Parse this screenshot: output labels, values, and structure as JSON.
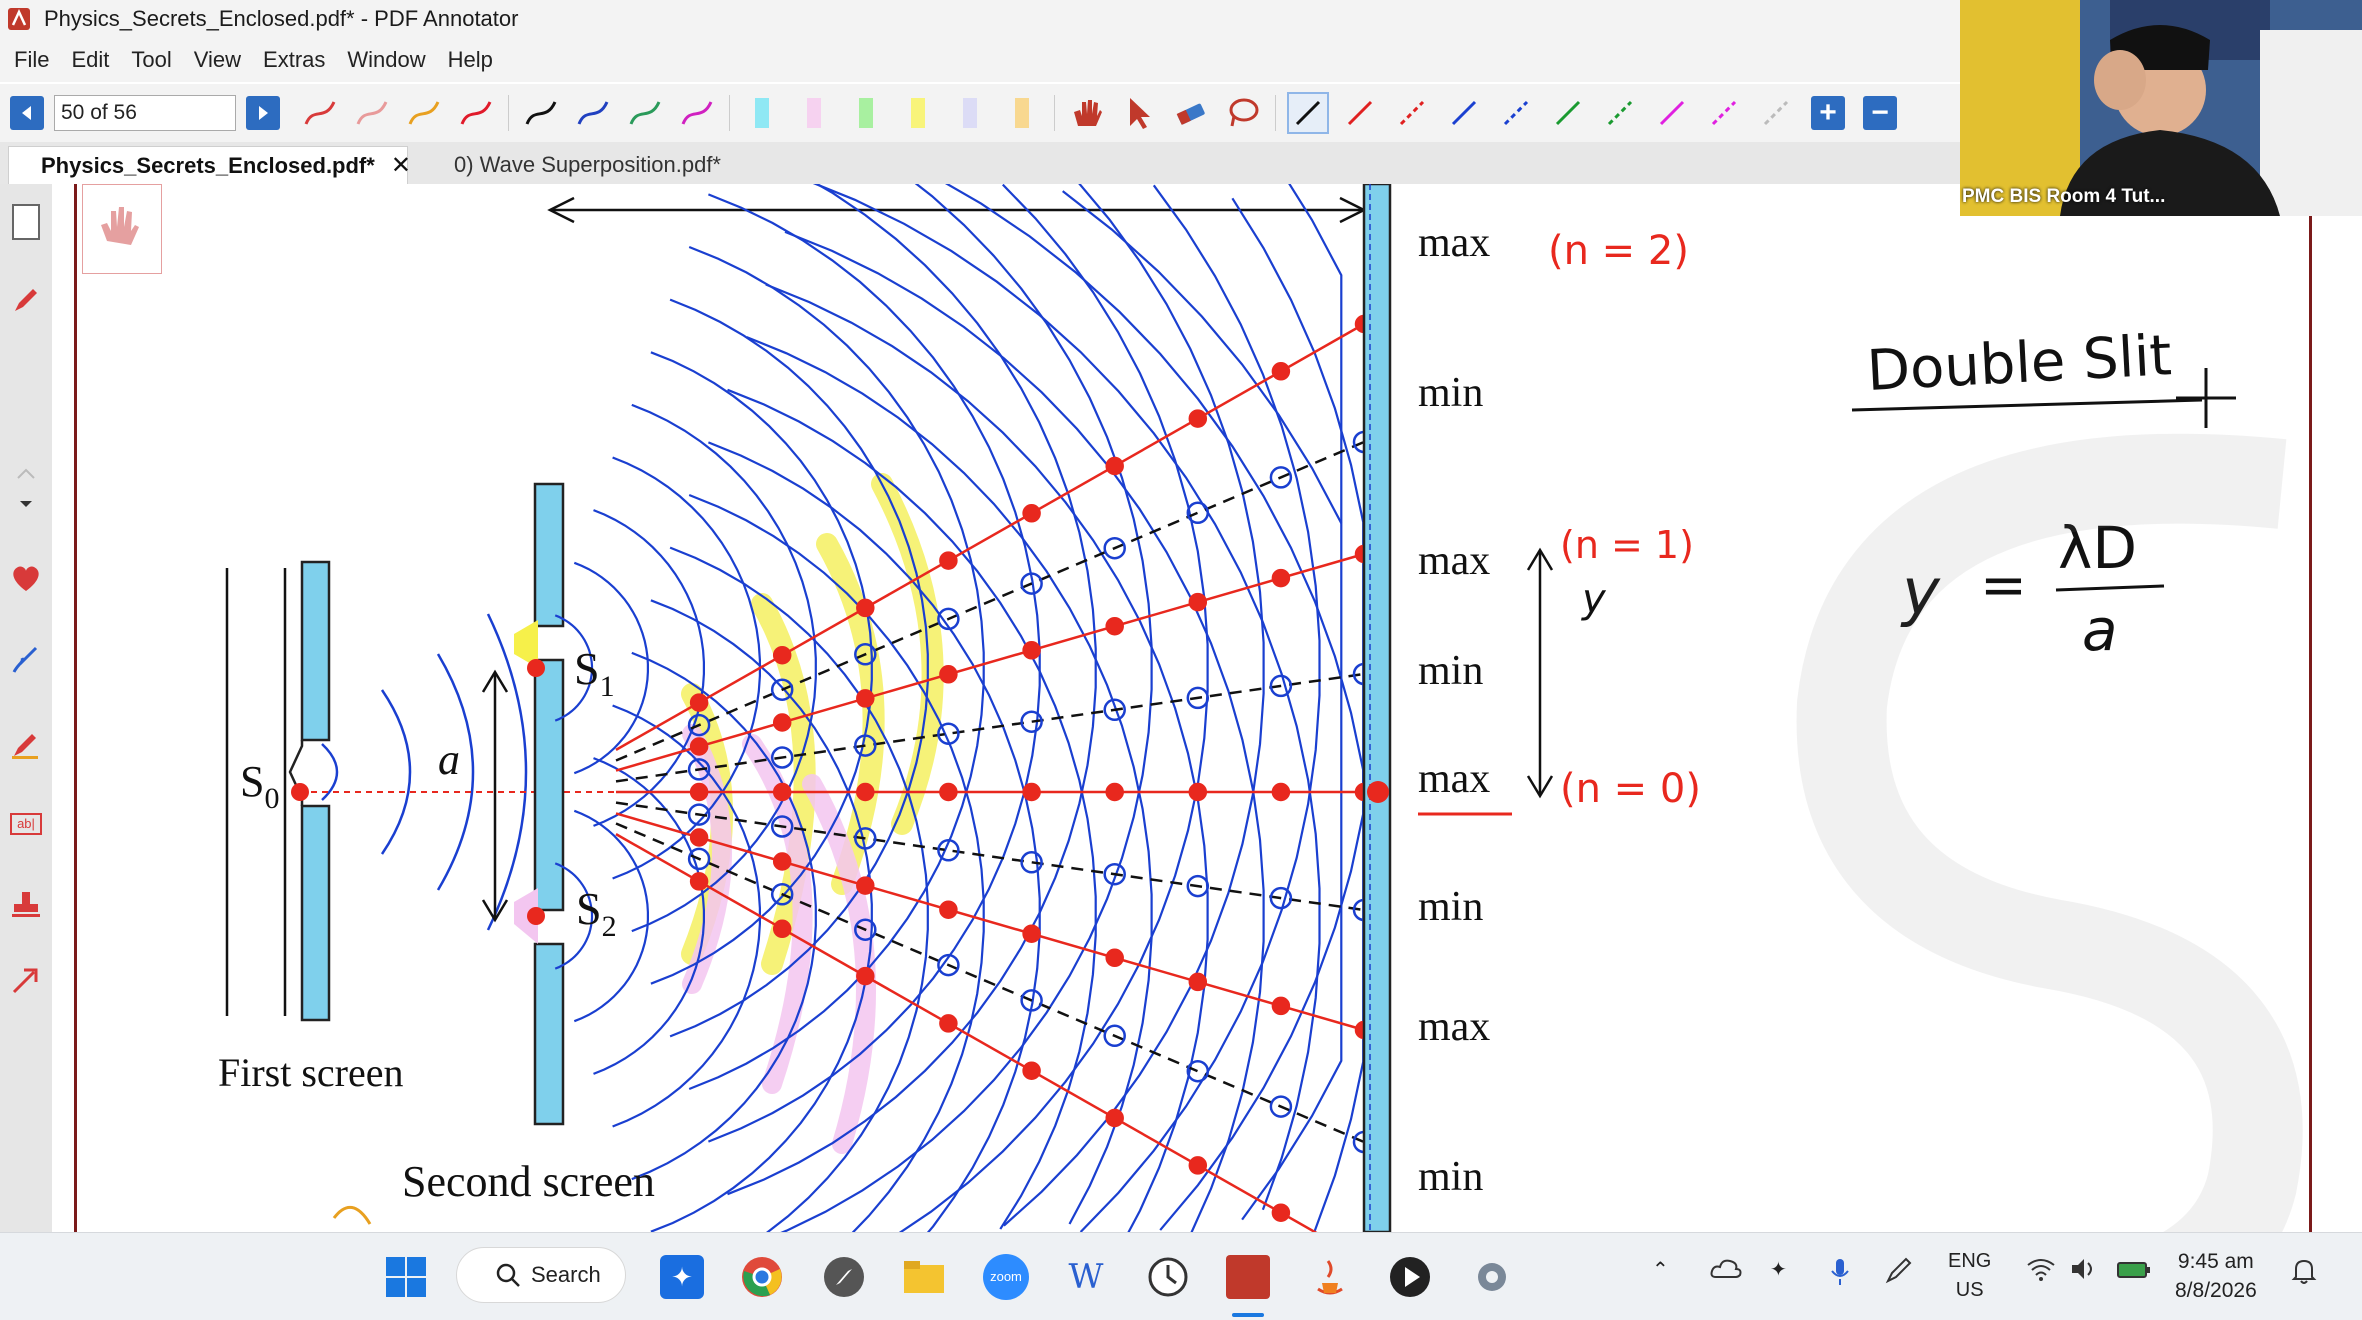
{
  "window": {
    "title": "Physics_Secrets_Enclosed.pdf* - PDF Annotator"
  },
  "menu": [
    "File",
    "Edit",
    "Tool",
    "View",
    "Extras",
    "Window",
    "Help"
  ],
  "toolbar": {
    "page_indicator": "50 of 56"
  },
  "tabs": [
    {
      "label": "Physics_Secrets_Enclosed.pdf*",
      "active": true
    },
    {
      "label": "0) Wave Superposition.pdf*",
      "active": false
    }
  ],
  "diagram": {
    "source_label": "S",
    "source_sub": "0",
    "slit1_label": "S",
    "slit1_sub": "1",
    "slit2_label": "S",
    "slit2_sub": "2",
    "separation_label": "a",
    "first_screen": "First screen",
    "second_screen": "Second screen",
    "screen_labels": [
      "max",
      "min",
      "max",
      "min",
      "max",
      "min",
      "max",
      "min"
    ]
  },
  "annotations": {
    "n2": "(n = 2)",
    "n1": "(n = 1)",
    "n0": "(n = 0)",
    "y_label": "y",
    "heading": "Double Slit",
    "formula_lhs": "y",
    "formula_eq": "=",
    "formula_num": "λD",
    "formula_den": "a"
  },
  "webcam": {
    "label": "PMC BIS Room 4 Tut..."
  },
  "taskbar": {
    "search_label": "Search",
    "language_top": "ENG",
    "language_bottom": "US",
    "time": "9:45 am",
    "date": "8/8/2026"
  },
  "colors": {
    "accent": "#2d6cc0",
    "annotation_red": "#e8281e",
    "wave_blue": "#1a4fd6",
    "page_border": "#7b1a1a"
  }
}
